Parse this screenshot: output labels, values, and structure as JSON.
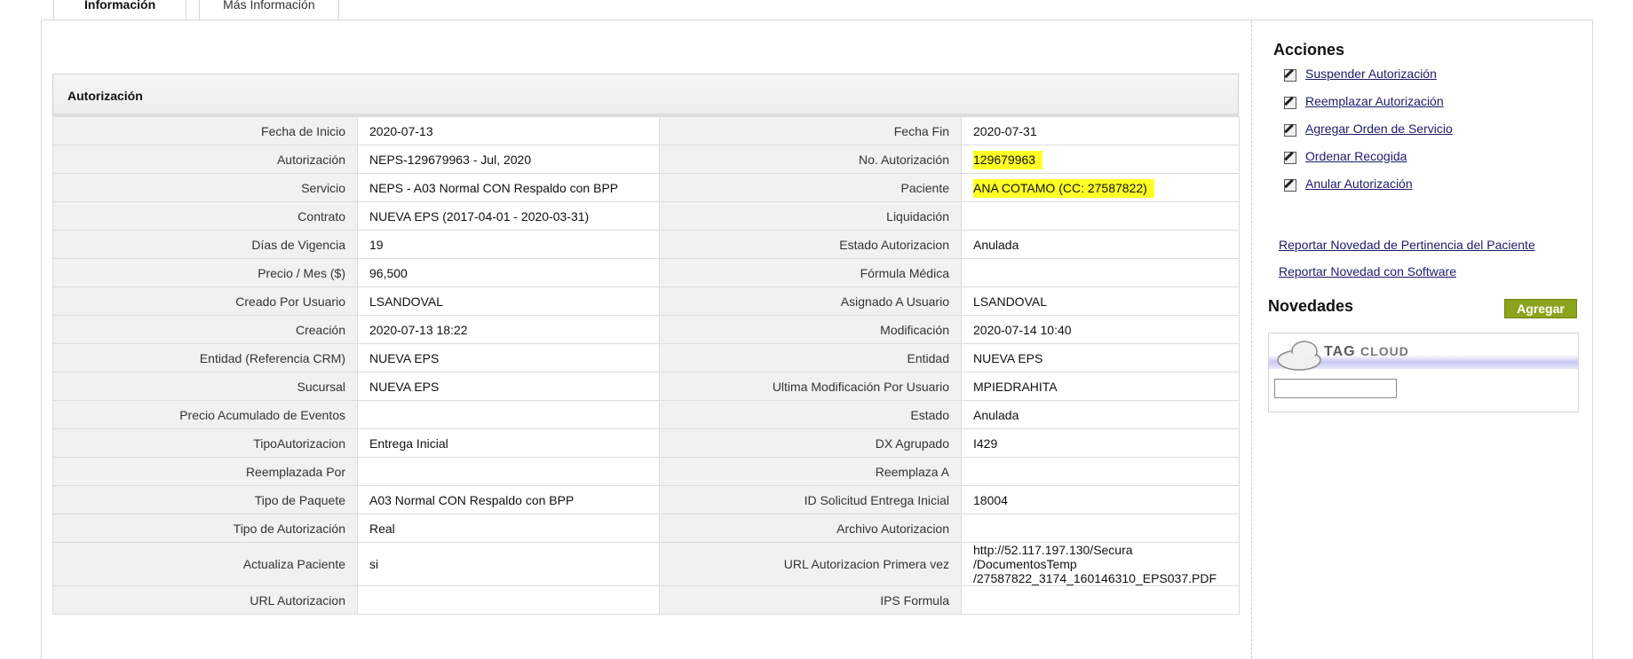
{
  "tabs": [
    {
      "label": "Información",
      "active": true
    },
    {
      "label": "Más Información",
      "active": false
    }
  ],
  "section": {
    "title": "Autorización"
  },
  "rows": [
    {
      "l1": "Fecha de Inicio",
      "v1": "2020-07-13",
      "l2": "Fecha Fin",
      "v2": "2020-07-31"
    },
    {
      "l1": "Autorización",
      "v1": "NEPS-129679963 - Jul, 2020",
      "l2": "No. Autorización",
      "v2": "129679963",
      "v2_highlight": true
    },
    {
      "l1": "Servicio",
      "v1": "NEPS - A03 Normal CON Respaldo con BPP",
      "l2": "Paciente",
      "v2": "ANA COTAMO (CC: 27587822)",
      "v2_highlight": true
    },
    {
      "l1": "Contrato",
      "v1": "NUEVA EPS (2017-04-01 - 2020-03-31)",
      "l2": "Liquidación",
      "v2": ""
    },
    {
      "l1": "Días de Vigencia",
      "v1": "19",
      "l2": "Estado Autorizacion",
      "v2": "Anulada"
    },
    {
      "l1": "Precio / Mes ($)",
      "v1": "96,500",
      "l2": "Fórmula Médica",
      "v2": ""
    },
    {
      "l1": "Creado Por Usuario",
      "v1": "LSANDOVAL",
      "l2": "Asignado A Usuario",
      "v2": "LSANDOVAL"
    },
    {
      "l1": "Creación",
      "v1": "2020-07-13 18:22",
      "l2": "Modificación",
      "v2": "2020-07-14 10:40"
    },
    {
      "l1": "Entidad (Referencia CRM)",
      "v1": "NUEVA EPS",
      "l2": "Entidad",
      "v2": "NUEVA EPS"
    },
    {
      "l1": "Sucursal",
      "v1": "NUEVA EPS",
      "l2": "Ultima Modificación Por Usuario",
      "v2": "MPIEDRAHITA"
    },
    {
      "l1": "Precio Acumulado de Eventos",
      "v1": "",
      "l2": "Estado",
      "v2": "Anulada"
    },
    {
      "l1": "TipoAutorizacion",
      "v1": "Entrega Inicial",
      "l2": "DX Agrupado",
      "v2": "I429"
    },
    {
      "l1": "Reemplazada Por",
      "v1": "",
      "l2": "Reemplaza A",
      "v2": ""
    },
    {
      "l1": "Tipo de Paquete",
      "v1": "A03 Normal CON Respaldo con BPP",
      "l2": "ID Solicitud Entrega Inicial",
      "v2": "18004"
    },
    {
      "l1": "Tipo de Autorización",
      "v1": "Real",
      "l2": "Archivo Autorizacion",
      "v2": ""
    },
    {
      "l1": "Actualiza Paciente",
      "v1": "si",
      "l2": "URL Autorizacion Primera vez",
      "v2": "http://52.117.197.130/Secura /DocumentosTemp /27587822_3174_160146310_EPS037.PDF",
      "tall": true
    },
    {
      "l1": "URL Autorizacion",
      "v1": "",
      "l2": "IPS Formula",
      "v2": ""
    }
  ],
  "actions": {
    "title": "Acciones",
    "items": [
      "Suspender Autorización",
      "Reemplazar Autorización",
      "Agregar Orden de Servicio",
      "Ordenar Recogida",
      "Anular Autorización"
    ]
  },
  "reports": [
    "Reportar Novedad de Pertinencia del Paciente",
    "Reportar Novedad con Software"
  ],
  "novedades": {
    "title": "Novedades",
    "add_label": "Agregar",
    "add_color": "#8aa51c"
  },
  "tag_cloud": {
    "word1": "TAG",
    "word2": "CLOUD",
    "input_value": ""
  },
  "colors": {
    "highlight": "#ffff26",
    "link": "#1c1c6b",
    "label_bg": "#f1f1f1"
  }
}
